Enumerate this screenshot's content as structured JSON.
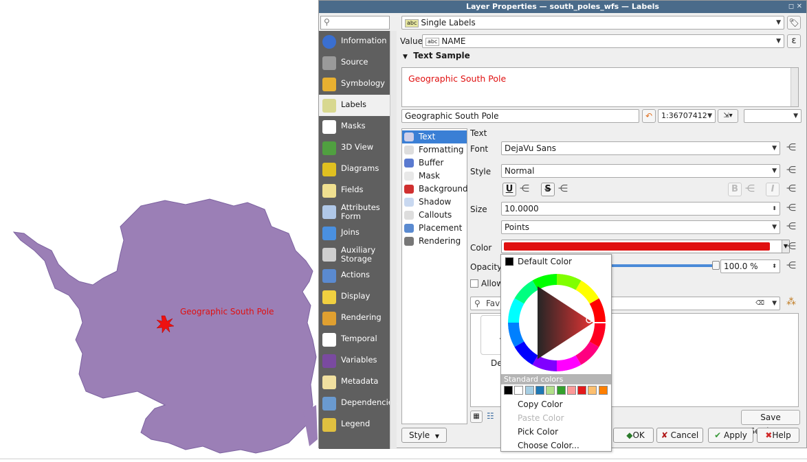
{
  "map": {
    "label": "Geographic South Pole"
  },
  "dialog": {
    "title": "Layer Properties — south_poles_wfs — Labels",
    "title_icons": "◻ ✕",
    "search_placeholder": "",
    "sidebar_items": [
      {
        "label": "Information",
        "icon": "info-icon"
      },
      {
        "label": "Source",
        "icon": "source-icon"
      },
      {
        "label": "Symbology",
        "icon": "symbology-icon"
      },
      {
        "label": "Labels",
        "icon": "labels-icon"
      },
      {
        "label": "Masks",
        "icon": "masks-icon"
      },
      {
        "label": "3D View",
        "icon": "3d-view-icon"
      },
      {
        "label": "Diagrams",
        "icon": "diagrams-icon"
      },
      {
        "label": "Fields",
        "icon": "fields-icon"
      },
      {
        "label": "Attributes\nForm",
        "icon": "attributes-form-icon"
      },
      {
        "label": "Joins",
        "icon": "joins-icon"
      },
      {
        "label": "Auxiliary\nStorage",
        "icon": "auxiliary-storage-icon"
      },
      {
        "label": "Actions",
        "icon": "actions-icon"
      },
      {
        "label": "Display",
        "icon": "display-icon"
      },
      {
        "label": "Rendering",
        "icon": "rendering-icon"
      },
      {
        "label": "Temporal",
        "icon": "temporal-icon"
      },
      {
        "label": "Variables",
        "icon": "variables-icon"
      },
      {
        "label": "Metadata",
        "icon": "metadata-icon"
      },
      {
        "label": "Dependencies",
        "icon": "dependencies-icon"
      },
      {
        "label": "Legend",
        "icon": "legend-icon"
      }
    ],
    "label_mode": "Single Labels",
    "value_label": "Value",
    "value_field": "NAME",
    "text_sample_header": "Text Sample",
    "text_sample": "Geographic South Pole",
    "sample_input": "Geographic South Pole",
    "scale": "1:36707412",
    "tree_items": [
      {
        "label": "Text",
        "selected": true
      },
      {
        "label": "Formatting",
        "selected": false
      },
      {
        "label": "Buffer",
        "selected": false
      },
      {
        "label": "Mask",
        "selected": false
      },
      {
        "label": "Background",
        "selected": false
      },
      {
        "label": "Shadow",
        "selected": false
      },
      {
        "label": "Callouts",
        "selected": false
      },
      {
        "label": "Placement",
        "selected": false
      },
      {
        "label": "Rendering",
        "selected": false
      }
    ],
    "text_section": "Text",
    "font_label": "Font",
    "font_value": "DejaVu Sans",
    "style_label": "Style",
    "style_value": "Normal",
    "size_label": "Size",
    "size_value": "10.0000",
    "unit_value": "Points",
    "color_label": "Color",
    "color_value": "#e01010",
    "opacity_label": "Opacity",
    "opacity_value": "100.0 %",
    "allow_label": "Allow",
    "favorites_placeholder": "Favo",
    "preview_label": "De",
    "save_settings": "Save Settings...",
    "style_button": "Style",
    "ok": "OK",
    "cancel": "Cancel",
    "apply": "Apply",
    "help": "Help"
  },
  "popup": {
    "default_color": "Default Color",
    "standard_colors_header": "Standard colors",
    "standard_colors": [
      "#000000",
      "#ffffff",
      "#a6cee3",
      "#1f78b4",
      "#b2df8a",
      "#33a02c",
      "#fb9a99",
      "#e31a1c",
      "#fdbf6f",
      "#ff7f00"
    ],
    "copy_color": "Copy Color",
    "paste_color": "Paste Color",
    "pick_color": "Pick Color",
    "choose_color": "Choose Color..."
  }
}
